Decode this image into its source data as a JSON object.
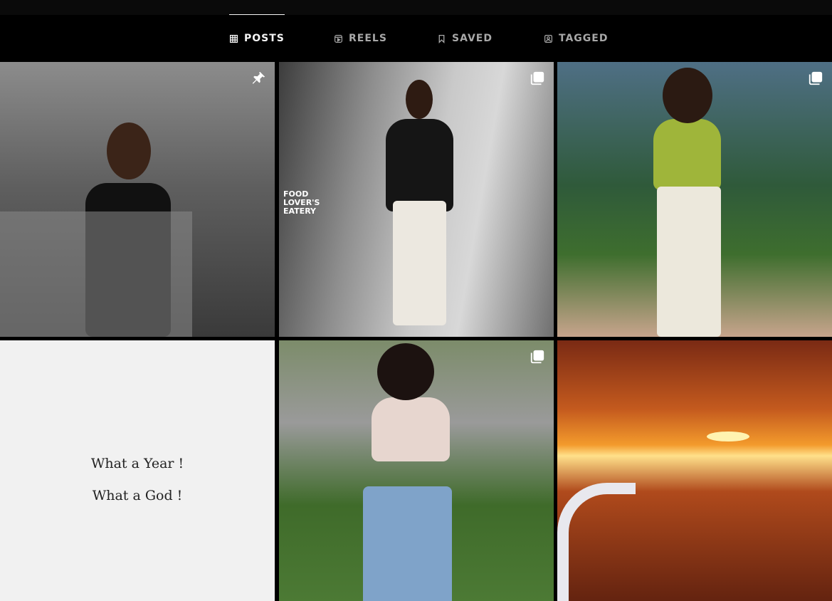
{
  "tabs": [
    {
      "label": "POSTS",
      "icon": "grid-icon",
      "active": true
    },
    {
      "label": "REELS",
      "icon": "reels-icon",
      "active": false
    },
    {
      "label": "SAVED",
      "icon": "bookmark-icon",
      "active": false
    },
    {
      "label": "TAGGED",
      "icon": "tagged-user-icon",
      "active": false
    }
  ],
  "posts": [
    {
      "overlay_icon": "pin-icon"
    },
    {
      "overlay_icon": "carousel-icon",
      "sign_text": "FOOD LOVER'S EATERY"
    },
    {
      "overlay_icon": "carousel-icon"
    },
    {
      "quote_line1": "What a Year !",
      "quote_line2": "What a God !"
    },
    {
      "overlay_icon": "carousel-icon"
    },
    {}
  ],
  "colors": {
    "background": "#000000",
    "active_tab": "#f5f5f5",
    "inactive_tab": "#a8a8a8"
  }
}
